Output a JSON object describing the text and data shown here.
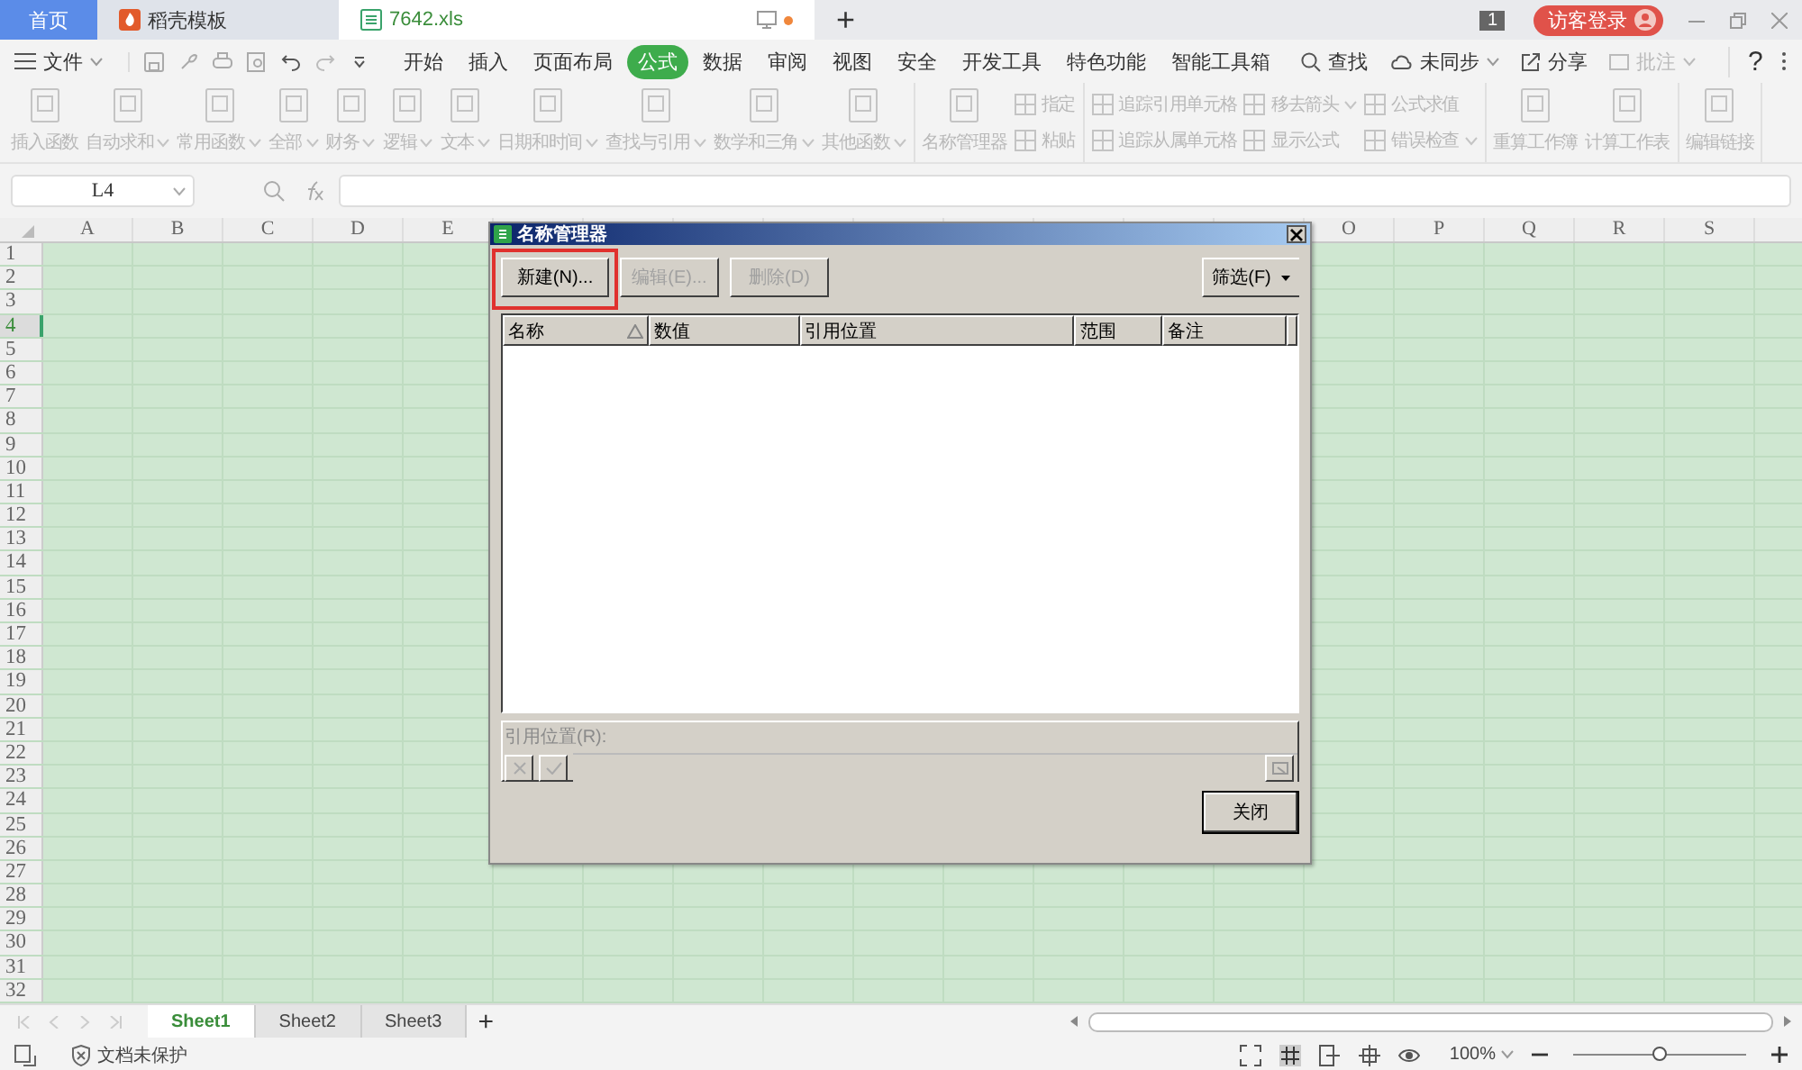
{
  "tab_bar": {
    "tabs": [
      {
        "kind": "home",
        "label": "首页",
        "selected": false,
        "unsaved": false
      },
      {
        "kind": "template",
        "label": "稻壳模板",
        "selected": false,
        "unsaved": false
      },
      {
        "kind": "file",
        "label": "7642.xls",
        "selected": true,
        "unsaved": true
      }
    ],
    "new_tab": "+",
    "badge": "1",
    "login": "访客登录"
  },
  "menu_bar": {
    "file": "文件",
    "tabs": [
      {
        "label": "开始",
        "selected": false
      },
      {
        "label": "插入",
        "selected": false
      },
      {
        "label": "页面布局",
        "selected": false
      },
      {
        "label": "公式",
        "selected": true
      },
      {
        "label": "数据",
        "selected": false
      },
      {
        "label": "审阅",
        "selected": false
      },
      {
        "label": "视图",
        "selected": false
      },
      {
        "label": "安全",
        "selected": false
      },
      {
        "label": "开发工具",
        "selected": false
      },
      {
        "label": "特色功能",
        "selected": false
      },
      {
        "label": "智能工具箱",
        "selected": false
      }
    ],
    "search": "查找",
    "sync": "未同步",
    "share": "分享",
    "comment": "批注",
    "help": "?"
  },
  "ribbon": {
    "disabled": true,
    "sections": [
      [
        {
          "kind": "large",
          "items": [
            {
              "label": "插入函数",
              "dropdown": false
            }
          ]
        },
        {
          "kind": "large",
          "items": [
            {
              "label": "自动求和",
              "dropdown": true
            }
          ]
        },
        {
          "kind": "large",
          "items": [
            {
              "label": "常用函数",
              "dropdown": true
            }
          ]
        },
        {
          "kind": "large",
          "items": [
            {
              "label": "全部",
              "dropdown": true
            }
          ]
        },
        {
          "kind": "large",
          "items": [
            {
              "label": "财务",
              "dropdown": true
            }
          ]
        },
        {
          "kind": "large",
          "items": [
            {
              "label": "逻辑",
              "dropdown": true
            }
          ]
        },
        {
          "kind": "large",
          "items": [
            {
              "label": "文本",
              "dropdown": true
            }
          ]
        },
        {
          "kind": "large",
          "items": [
            {
              "label": "日期和时间",
              "dropdown": true
            }
          ]
        },
        {
          "kind": "large",
          "items": [
            {
              "label": "查找与引用",
              "dropdown": true
            }
          ]
        },
        {
          "kind": "large",
          "items": [
            {
              "label": "数学和三角",
              "dropdown": true
            }
          ]
        },
        {
          "kind": "large",
          "items": [
            {
              "label": "其他函数",
              "dropdown": true
            }
          ]
        }
      ],
      [
        {
          "kind": "large",
          "items": [
            {
              "label": "名称管理器",
              "dropdown": false
            }
          ]
        },
        {
          "kind": "small",
          "items": [
            {
              "label": "指定",
              "dropdown": false
            },
            {
              "label": "粘贴",
              "dropdown": false
            }
          ]
        }
      ],
      [
        {
          "kind": "small",
          "items": [
            {
              "label": "追踪引用单元格",
              "dropdown": false
            },
            {
              "label": "追踪从属单元格",
              "dropdown": false
            }
          ]
        },
        {
          "kind": "small",
          "items": [
            {
              "label": "移去箭头",
              "dropdown": true
            },
            {
              "label": "显示公式",
              "dropdown": false
            }
          ]
        },
        {
          "kind": "small",
          "items": [
            {
              "label": "公式求值",
              "dropdown": false
            },
            {
              "label": "错误检查",
              "dropdown": true
            }
          ]
        }
      ],
      [
        {
          "kind": "large",
          "items": [
            {
              "label": "重算工作簿",
              "dropdown": false
            }
          ]
        },
        {
          "kind": "large",
          "items": [
            {
              "label": "计算工作表",
              "dropdown": false
            }
          ]
        }
      ],
      [
        {
          "kind": "large",
          "items": [
            {
              "label": "编辑链接",
              "dropdown": false
            }
          ]
        }
      ]
    ]
  },
  "formula_bar": {
    "cell": "L4"
  },
  "grid": {
    "columns_left": [
      "A",
      "B",
      "C",
      "D",
      "E"
    ],
    "columns_right": [
      "O",
      "P",
      "Q",
      "R",
      "S"
    ],
    "rows": [
      {
        "label": "1",
        "selected": false
      },
      {
        "label": "2",
        "selected": false
      },
      {
        "label": "3",
        "selected": false
      },
      {
        "label": "4",
        "selected": true
      },
      {
        "label": "5",
        "selected": false
      },
      {
        "label": "6",
        "selected": false
      },
      {
        "label": "7",
        "selected": false
      },
      {
        "label": "8",
        "selected": false
      },
      {
        "label": "9",
        "selected": false
      },
      {
        "label": "10",
        "selected": false
      },
      {
        "label": "11",
        "selected": false
      },
      {
        "label": "12",
        "selected": false
      },
      {
        "label": "13",
        "selected": false
      },
      {
        "label": "14",
        "selected": false
      },
      {
        "label": "15",
        "selected": false
      },
      {
        "label": "16",
        "selected": false
      },
      {
        "label": "17",
        "selected": false
      },
      {
        "label": "18",
        "selected": false
      },
      {
        "label": "19",
        "selected": false
      },
      {
        "label": "20",
        "selected": false
      },
      {
        "label": "21",
        "selected": false
      },
      {
        "label": "22",
        "selected": false
      },
      {
        "label": "23",
        "selected": false
      },
      {
        "label": "24",
        "selected": false
      },
      {
        "label": "25",
        "selected": false
      },
      {
        "label": "26",
        "selected": false
      },
      {
        "label": "27",
        "selected": false
      },
      {
        "label": "28",
        "selected": false
      },
      {
        "label": "29",
        "selected": false
      },
      {
        "label": "30",
        "selected": false
      },
      {
        "label": "31",
        "selected": false
      },
      {
        "label": "32",
        "selected": false
      }
    ]
  },
  "dialog": {
    "title": "名称管理器",
    "buttons": [
      {
        "label": "新建(N)...",
        "disabled": false,
        "annotated": true
      },
      {
        "label": "编辑(E)...",
        "disabled": true,
        "annotated": false
      },
      {
        "label": "删除(D)",
        "disabled": true,
        "annotated": false
      }
    ],
    "filter": "筛选(F)",
    "columns": [
      {
        "label": "名称",
        "sorted": true
      },
      {
        "label": "数值",
        "sorted": false
      },
      {
        "label": "引用位置",
        "sorted": false
      },
      {
        "label": "范围",
        "sorted": false
      },
      {
        "label": "备注",
        "sorted": false
      }
    ],
    "ref_label": "引用位置(R):",
    "close": "关闭"
  },
  "sheet_bar": {
    "sheets": [
      {
        "label": "Sheet1",
        "selected": true
      },
      {
        "label": "Sheet2",
        "selected": false
      },
      {
        "label": "Sheet3",
        "selected": false
      }
    ],
    "add": "+"
  },
  "status_bar": {
    "protection": "文档未保护",
    "zoom": "100%",
    "zoom_slider": {
      "level": 0.5
    }
  }
}
